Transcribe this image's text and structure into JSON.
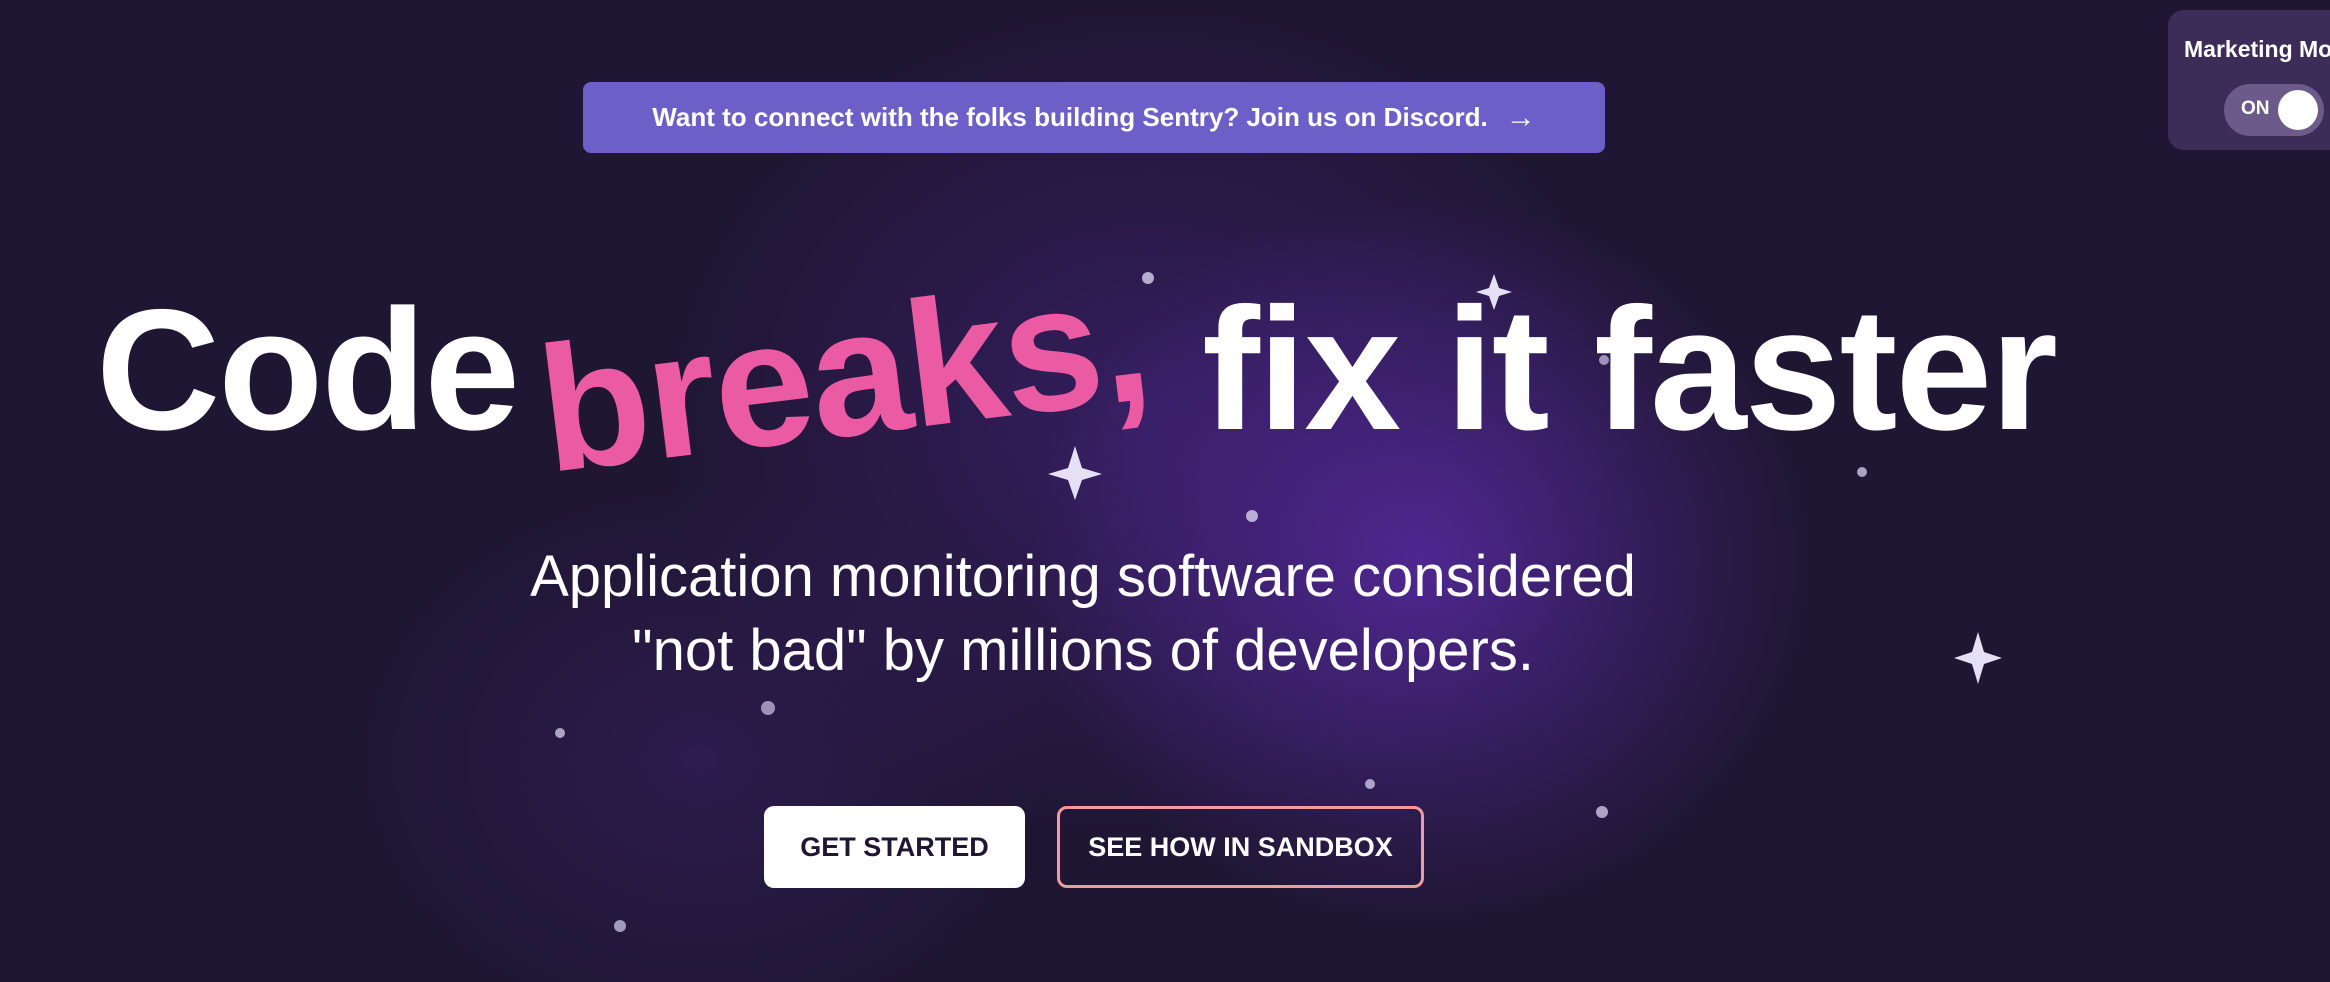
{
  "announcement": {
    "text": "Want to connect with the folks building Sentry? Join us on Discord.",
    "arrow": "→"
  },
  "marketing_mode": {
    "label": "Marketing Mode",
    "state": "ON",
    "enabled": true
  },
  "hero": {
    "headline_part1": "Code",
    "headline_highlight": "breaks,",
    "headline_part2": "fix it faster",
    "subhead_line1": "Application monitoring software considered",
    "subhead_line2": "\"not bad\" by millions of developers."
  },
  "buttons": {
    "get_started": "GET STARTED",
    "sandbox": "SEE HOW IN SANDBOX"
  },
  "colors": {
    "background": "#1f1633",
    "announce_bg": "#6c5fc7",
    "highlight": "#ea5ba4",
    "sandbox_border": "#f19a9f"
  }
}
